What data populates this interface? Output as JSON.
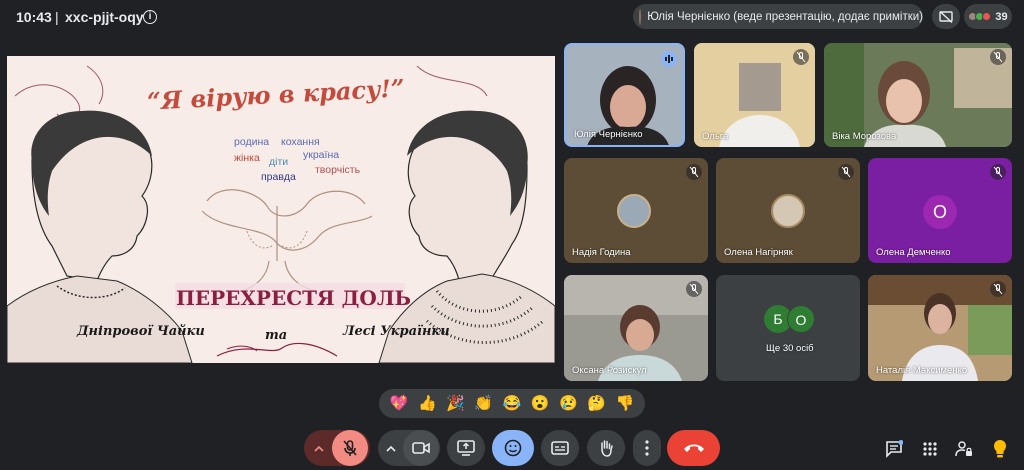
{
  "topbar": {
    "time": "10:43",
    "separator": "|",
    "meeting_code": "xxc-pjjt-oqy",
    "presenter_label": "Юлія Чернієнко (веде презентацію, додає примітки)",
    "participants_count": "39"
  },
  "slide": {
    "title": "“Я вірую в красу!”",
    "word_cloud": [
      "родина",
      "кохання",
      "жінка",
      "діти",
      "україна",
      "правда",
      "творчість"
    ],
    "banner": "ПЕРЕХРЕСТЯ ДОЛЬ",
    "left_name": "Дніпрової Чайки",
    "connector": "та",
    "right_name": "Лесі Українки"
  },
  "participants": [
    {
      "name": "Юлія Чернієнко",
      "speaking": true
    },
    {
      "name": "Ольга",
      "muted": true
    },
    {
      "name": "Віка Морозова",
      "muted": true
    },
    {
      "name": "Надія Година",
      "muted": true
    },
    {
      "name": "Олена Нагірняк",
      "muted": true
    },
    {
      "name": "Олена Демченко",
      "initial": "О",
      "muted": true
    },
    {
      "name": "Оксана Розискул",
      "muted": true
    },
    {
      "name": "Ще 30 осіб",
      "initials": [
        "Б",
        "О"
      ]
    },
    {
      "name": "Наталія Максименко",
      "muted": true
    }
  ],
  "reactions": [
    "💖",
    "👍",
    "🎉",
    "👏",
    "😂",
    "😮",
    "😢",
    "🤔",
    "👎"
  ],
  "colors": {
    "background": "#202124",
    "control": "#3c4043",
    "active": "#8ab4f8",
    "end_call": "#ea4335",
    "mic_off": "#f28b82",
    "demchenko_tile": "#7b1fa2",
    "b_avatar": "#2e7d32",
    "o_avatar": "#2e7d32"
  }
}
